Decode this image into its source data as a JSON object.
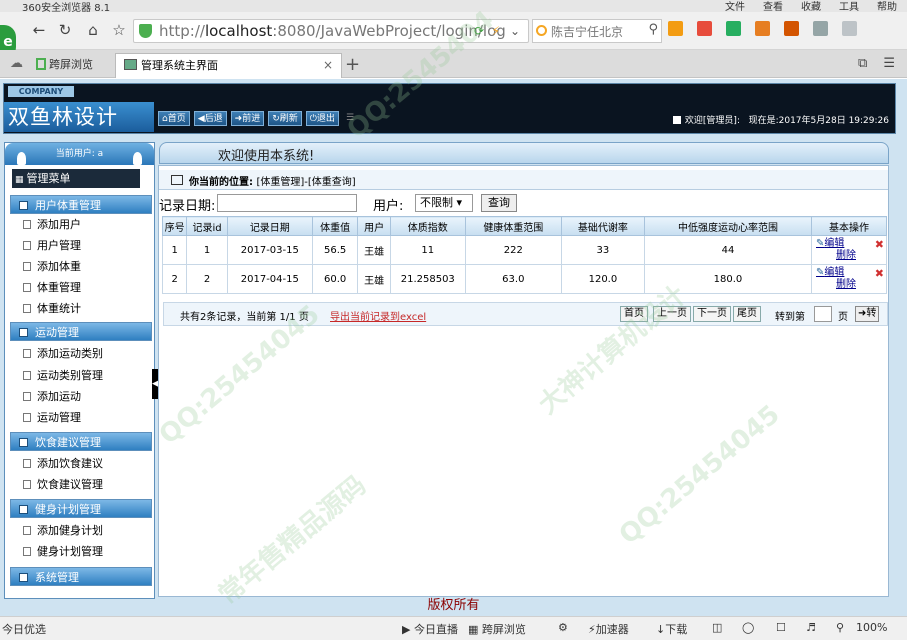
{
  "browser": {
    "title": "360安全浏览器 8.1",
    "top_menus": [
      "文件",
      "查看",
      "收藏",
      "工具",
      "帮助"
    ],
    "url_prefix": "http://",
    "url_host": "localhost",
    "url_rest": ":8080/JavaWebProject/login/log",
    "search_placeholder": "陈吉宁任北京",
    "tabs": [
      {
        "label": "跨屏浏览"
      },
      {
        "label": "管理系统主界面"
      }
    ],
    "status": {
      "left": "今日优选",
      "live": "今日直播",
      "cross": "跨屏浏览",
      "accel": "加速器",
      "download": "下载",
      "zoom": "100%"
    }
  },
  "header": {
    "company": "COMPANY",
    "brand": "双鱼林设计",
    "nav": [
      "首页",
      "后退",
      "前进",
      "刷新",
      "退出"
    ],
    "welcome": "欢迎[管理员]:",
    "now_label": "现在是:",
    "datetime": "2017年5月28日 19:29:26"
  },
  "sidebar": {
    "current_user": "当前用户: a",
    "menu_title": "管理菜单",
    "sections": [
      {
        "title": "用户体重管理",
        "items": [
          "添加用户",
          "用户管理",
          "添加体重",
          "体重管理",
          "体重统计"
        ]
      },
      {
        "title": "运动管理",
        "items": [
          "添加运动类别",
          "运动类别管理",
          "添加运动",
          "运动管理"
        ]
      },
      {
        "title": "饮食建议管理",
        "items": [
          "添加饮食建议",
          "饮食建议管理"
        ]
      },
      {
        "title": "健身计划管理",
        "items": [
          "添加健身计划",
          "健身计划管理"
        ]
      },
      {
        "title": "系统管理",
        "items": []
      }
    ]
  },
  "main": {
    "welcome": "欢迎使用本系统!",
    "position_label": "你当前的位置:",
    "position_value": "[体重管理]-[体重查询]",
    "search": {
      "date_label": "记录日期:",
      "date_value": "",
      "user_label": "用户:",
      "user_selected": "不限制",
      "query_button": "查询"
    },
    "table": {
      "headers": [
        "序号",
        "记录id",
        "记录日期",
        "体重值",
        "用户",
        "体质指数",
        "健康体重范围",
        "基础代谢率",
        "中低强度运动心率范围",
        "基本操作"
      ],
      "rows": [
        [
          "1",
          "1",
          "2017-03-15",
          "56.5",
          "王雄",
          "11",
          "222",
          "33",
          "44"
        ],
        [
          "2",
          "2",
          "2017-04-15",
          "60.0",
          "王雄",
          "21.258503",
          "63.0",
          "120.0",
          "180.0"
        ]
      ],
      "edit_label": "编辑",
      "delete_label": "删除"
    },
    "pager": {
      "info": "共有2条记录，当前第 1/1 页",
      "export": "导出当前记录到excel",
      "first": "首页",
      "prev": "上一页",
      "next": "下一页",
      "last": "尾页",
      "goto_label": "转到第",
      "page_unit": "页",
      "go": "转"
    }
  },
  "footer": "版权所有"
}
